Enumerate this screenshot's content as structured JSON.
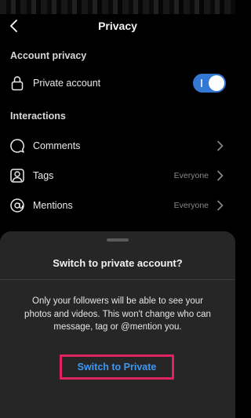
{
  "header": {
    "title": "Privacy"
  },
  "account_privacy": {
    "section_title": "Account privacy",
    "private_account_label": "Private account",
    "private_account_enabled": true
  },
  "interactions": {
    "section_title": "Interactions",
    "items": [
      {
        "label": "Comments",
        "value": "",
        "icon": "comment-icon"
      },
      {
        "label": "Tags",
        "value": "Everyone",
        "icon": "tag-person-icon"
      },
      {
        "label": "Mentions",
        "value": "Everyone",
        "icon": "at-sign-icon"
      }
    ]
  },
  "sheet": {
    "title": "Switch to private account?",
    "body": "Only your followers will be able to see your photos and videos. This won't change who can message, tag or @mention you.",
    "confirm_label": "Switch to Private"
  },
  "colors": {
    "toggle_on": "#3478d6",
    "link_blue": "#3f97f0",
    "highlight": "#e0225e",
    "sheet_bg": "#262626"
  }
}
